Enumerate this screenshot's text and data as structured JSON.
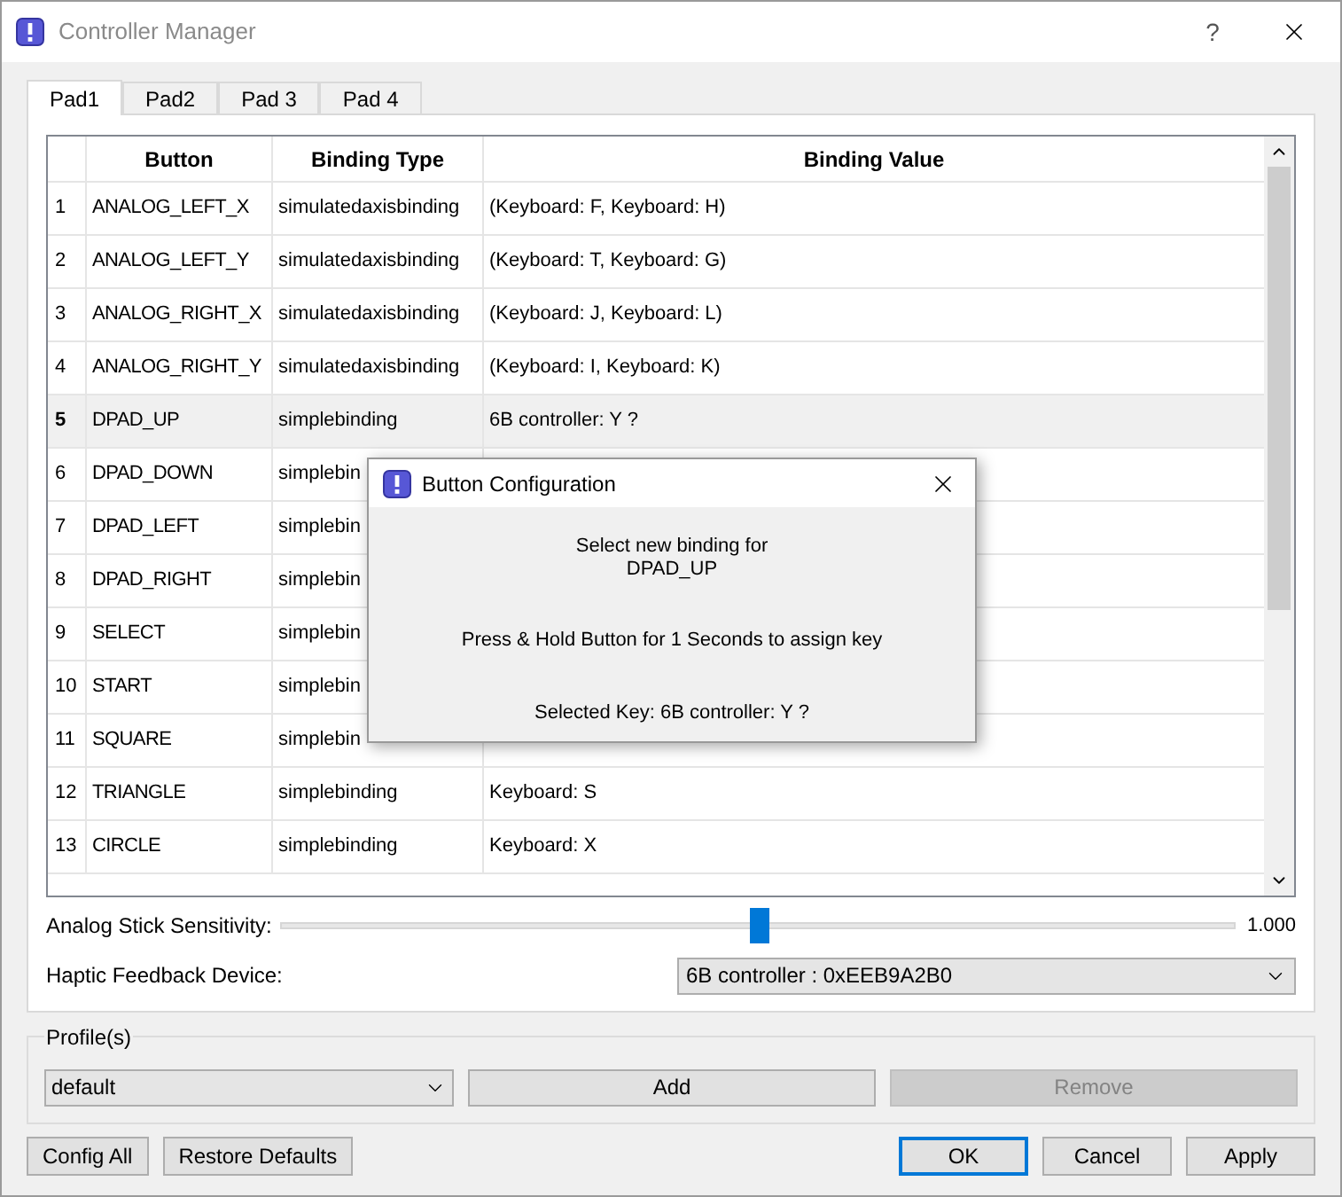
{
  "window": {
    "title": "Controller Manager",
    "help": "?"
  },
  "tabs": [
    {
      "label": "Pad1",
      "selected": true
    },
    {
      "label": "Pad2",
      "selected": false
    },
    {
      "label": "Pad 3",
      "selected": false
    },
    {
      "label": "Pad 4",
      "selected": false
    }
  ],
  "table": {
    "columns": [
      "Button",
      "Binding Type",
      "Binding Value"
    ],
    "rows": [
      {
        "index": "1",
        "button": "ANALOG_LEFT_X",
        "binding_type": "simulatedaxisbinding",
        "binding_value": "(Keyboard: F, Keyboard: H)",
        "selected": false
      },
      {
        "index": "2",
        "button": "ANALOG_LEFT_Y",
        "binding_type": "simulatedaxisbinding",
        "binding_value": "(Keyboard: T, Keyboard: G)",
        "selected": false
      },
      {
        "index": "3",
        "button": "ANALOG_RIGHT_X",
        "binding_type": "simulatedaxisbinding",
        "binding_value": "(Keyboard: J, Keyboard: L)",
        "selected": false
      },
      {
        "index": "4",
        "button": "ANALOG_RIGHT_Y",
        "binding_type": "simulatedaxisbinding",
        "binding_value": "(Keyboard: I, Keyboard: K)",
        "selected": false
      },
      {
        "index": "5",
        "button": "DPAD_UP",
        "binding_type": "simplebinding",
        "binding_value": "6B controller: Y ?",
        "selected": true
      },
      {
        "index": "6",
        "button": "DPAD_DOWN",
        "binding_type": "simplebin",
        "selected": false
      },
      {
        "index": "7",
        "button": "DPAD_LEFT",
        "binding_type": "simplebin",
        "selected": false
      },
      {
        "index": "8",
        "button": "DPAD_RIGHT",
        "binding_type": "simplebin",
        "selected": false
      },
      {
        "index": "9",
        "button": "SELECT",
        "binding_type": "simplebin",
        "selected": false
      },
      {
        "index": "10",
        "button": "START",
        "binding_type": "simplebin",
        "selected": false
      },
      {
        "index": "11",
        "button": "SQUARE",
        "binding_type": "simplebin",
        "selected": false
      },
      {
        "index": "12",
        "button": "TRIANGLE",
        "binding_type": "simplebinding",
        "binding_value": "Keyboard: S",
        "selected": false
      },
      {
        "index": "13",
        "button": "CIRCLE",
        "binding_type": "simplebinding",
        "binding_value": "Keyboard: X",
        "selected": false
      }
    ]
  },
  "sensitivity": {
    "label": "Analog Stick Sensitivity:",
    "level": 0.5,
    "reading": "1.000"
  },
  "haptic": {
    "label": "Haptic Feedback Device:",
    "value": "6B controller : 0xEEB9A2B0"
  },
  "profiles": {
    "title": "Profile(s)",
    "value": "default",
    "buttons": [
      {
        "label": "Add",
        "disabled": false
      },
      {
        "label": "Remove",
        "disabled": true
      }
    ]
  },
  "footer_left": [
    "Config All",
    "Restore Defaults"
  ],
  "footer_right": [
    {
      "label": "OK",
      "default": true
    },
    {
      "label": "Cancel",
      "default": false
    },
    {
      "label": "Apply",
      "default": false
    }
  ],
  "dialog": {
    "title": "Button Configuration",
    "lines": [
      "Select new binding for",
      "DPAD_UP"
    ],
    "instruction": "Press & Hold Button for 1 Seconds to assign key",
    "selected": "Selected Key: 6B controller: Y ?"
  }
}
